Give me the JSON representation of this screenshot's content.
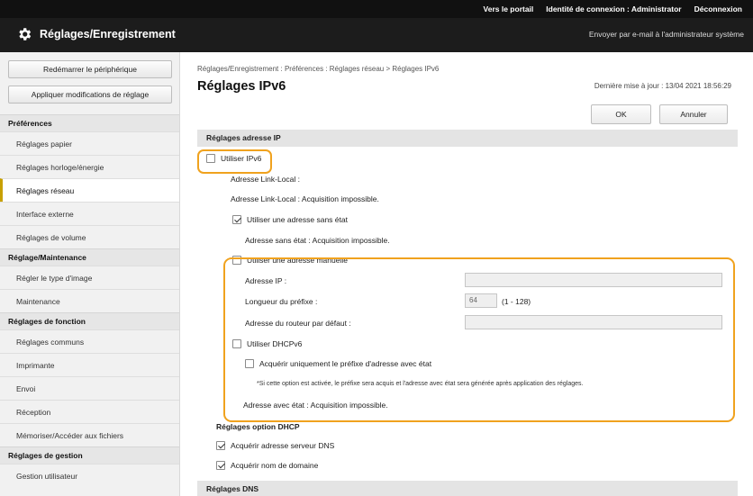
{
  "topbar": {
    "links": [
      "Vers le portail",
      "Identité de connexion : Administrator",
      "Déconnexion"
    ]
  },
  "header": {
    "title": "Réglages/Enregistrement",
    "right_link": "Envoyer par e-mail à l'administrateur système"
  },
  "sidebar": {
    "buttons": [
      "Redémarrer le périphérique",
      "Appliquer modifications de réglage"
    ],
    "sections": [
      {
        "title": "Préférences",
        "items": [
          "Réglages papier",
          "Réglages horloge/énergie",
          "Réglages réseau",
          "Interface externe",
          "Réglages de volume"
        ]
      },
      {
        "title": "Réglage/Maintenance",
        "items": [
          "Régler le type d'image",
          "Maintenance"
        ]
      },
      {
        "title": "Réglages de fonction",
        "items": [
          "Réglages communs",
          "Imprimante",
          "Envoi",
          "Réception",
          "Mémoriser/Accéder aux fichiers"
        ]
      },
      {
        "title": "Réglages de gestion",
        "items": [
          "Gestion utilisateur"
        ]
      }
    ],
    "active_item": "Réglages réseau"
  },
  "main": {
    "breadcrumb": "Réglages/Enregistrement : Préférences : Réglages réseau > Réglages IPv6",
    "title": "Réglages IPv6",
    "last_updated": "Dernière mise à jour : 13/04 2021 18:56:29",
    "ok_label": "OK",
    "cancel_label": "Annuler"
  },
  "form": {
    "ip_section": "Réglages adresse IP",
    "use_ipv6": {
      "label": "Utiliser IPv6",
      "checked": false
    },
    "link_local_label": "Adresse Link-Local :",
    "link_local_status": "Adresse Link-Local : Acquisition impossible.",
    "stateless": {
      "label": "Utiliser une adresse sans état",
      "checked": true
    },
    "stateless_status": "Adresse sans état : Acquisition impossible.",
    "manual": {
      "label": "Utiliser une adresse manuelle",
      "checked": false
    },
    "ip_address_label": "Adresse IP :",
    "ip_address_value": "",
    "prefix_label": "Longueur du préfixe :",
    "prefix_value": "64",
    "prefix_range": "(1 - 128)",
    "router_label": "Adresse du routeur par défaut :",
    "router_value": "",
    "dhcpv6": {
      "label": "Utiliser DHCPv6",
      "checked": false
    },
    "prefix_only": {
      "label": "Acquérir uniquement le préfixe d'adresse avec état",
      "checked": false
    },
    "note": "*Si cette option est activée, le préfixe sera acquis et l'adresse avec état sera générée après application des réglages.",
    "stateful_status": "Adresse avec état : Acquisition impossible.",
    "dhcp_section": "Réglages option DHCP",
    "dns_server": {
      "label": "Acquérir adresse serveur DNS",
      "checked": true
    },
    "domain_name": {
      "label": "Acquérir nom de domaine",
      "checked": true
    },
    "dns_section": "Réglages DNS"
  },
  "colors": {
    "highlight": "#f0a21e",
    "topbar": "#111111",
    "header": "#1c1c1c"
  }
}
